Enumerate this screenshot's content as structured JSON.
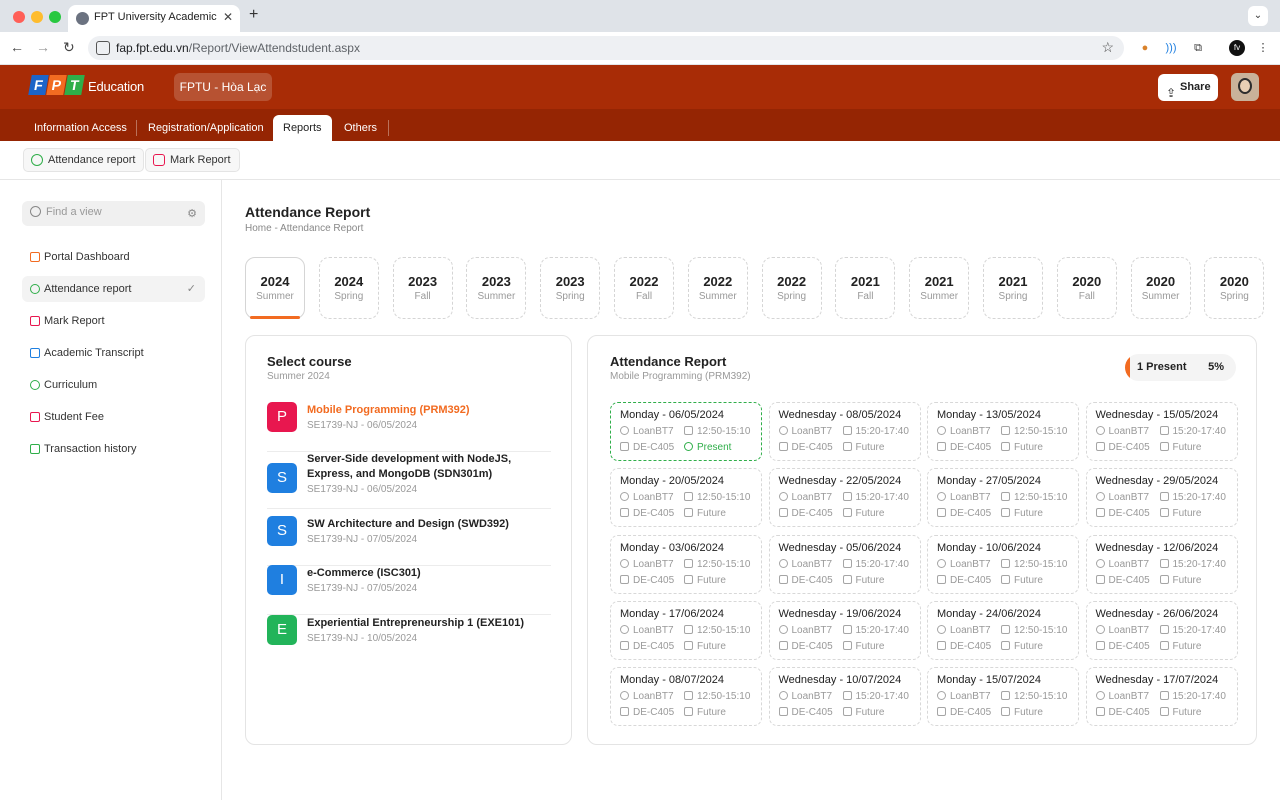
{
  "browser": {
    "tab_title": "FPT University Academic Portal",
    "url_host": "fap.fpt.edu.vn",
    "url_path": "/Report/ViewAttendstudent.aspx",
    "ext_profile": "fv"
  },
  "header": {
    "logo_letters": [
      "F",
      "P",
      "T"
    ],
    "logo_text": "Education",
    "campus": "FPTU - Hòa Lạc",
    "share_label": "Share",
    "colors": {
      "primary": "#a82c06",
      "menu": "#952503",
      "accent": "#f26b21",
      "success": "#2fae49"
    }
  },
  "menu": [
    "Information Access",
    "Registration/Application",
    "Reports",
    "Others"
  ],
  "menu_active": "Reports",
  "subnav": [
    "Attendance report",
    "Mark Report"
  ],
  "sidebar": {
    "search_placeholder": "Find a view",
    "items": [
      {
        "label": "Portal Dashboard",
        "icon": "dashboard-icon"
      },
      {
        "label": "Attendance report",
        "icon": "attendance-icon",
        "active": true
      },
      {
        "label": "Mark Report",
        "icon": "chart-icon"
      },
      {
        "label": "Academic Transcript",
        "icon": "transcript-icon"
      },
      {
        "label": "Curriculum",
        "icon": "curriculum-icon"
      },
      {
        "label": "Student Fee",
        "icon": "fee-icon"
      },
      {
        "label": "Transaction history",
        "icon": "history-icon"
      }
    ]
  },
  "page": {
    "title": "Attendance Report",
    "breadcrumb_home": "Home",
    "breadcrumb_sep": "-",
    "breadcrumb_current": "Attendance Report"
  },
  "terms": [
    {
      "year": "2024",
      "season": "Summer",
      "active": true
    },
    {
      "year": "2024",
      "season": "Spring"
    },
    {
      "year": "2023",
      "season": "Fall"
    },
    {
      "year": "2023",
      "season": "Summer"
    },
    {
      "year": "2023",
      "season": "Spring"
    },
    {
      "year": "2022",
      "season": "Fall"
    },
    {
      "year": "2022",
      "season": "Summer"
    },
    {
      "year": "2022",
      "season": "Spring"
    },
    {
      "year": "2021",
      "season": "Fall"
    },
    {
      "year": "2021",
      "season": "Summer"
    },
    {
      "year": "2021",
      "season": "Spring"
    },
    {
      "year": "2020",
      "season": "Fall"
    },
    {
      "year": "2020",
      "season": "Summer"
    },
    {
      "year": "2020",
      "season": "Spring"
    }
  ],
  "courses": {
    "title": "Select course",
    "subtitle": "Summer 2024",
    "items": [
      {
        "letter": "P",
        "color": "#e8174f",
        "name": "Mobile Programming (PRM392)",
        "meta": "SE1739-NJ - 06/05/2024",
        "active": true
      },
      {
        "letter": "S",
        "color": "#1f7fe0",
        "name": "Server-Side development with NodeJS, Express, and MongoDB (SDN301m)",
        "meta": "SE1739-NJ - 06/05/2024"
      },
      {
        "letter": "S",
        "color": "#1f7fe0",
        "name": "SW Architecture and Design (SWD392)",
        "meta": "SE1739-NJ - 07/05/2024"
      },
      {
        "letter": "I",
        "color": "#1f7fe0",
        "name": "e-Commerce (ISC301)",
        "meta": "SE1739-NJ - 07/05/2024"
      },
      {
        "letter": "E",
        "color": "#22b45a",
        "name": "Experiential Entrepreneurship 1 (EXE101)",
        "meta": "SE1739-NJ - 10/05/2024"
      }
    ]
  },
  "attendance": {
    "title": "Attendance Report",
    "subtitle": "Mobile Programming (PRM392)",
    "summary_label": "1 Present",
    "summary_pct": "5%",
    "slots": [
      {
        "date": "Monday - 06/05/2024",
        "lecturer": "LoanBT7",
        "time": "12:50-15:10",
        "room": "DE-C405",
        "status": "Present"
      },
      {
        "date": "Wednesday - 08/05/2024",
        "lecturer": "LoanBT7",
        "time": "15:20-17:40",
        "room": "DE-C405",
        "status": "Future"
      },
      {
        "date": "Monday - 13/05/2024",
        "lecturer": "LoanBT7",
        "time": "12:50-15:10",
        "room": "DE-C405",
        "status": "Future"
      },
      {
        "date": "Wednesday - 15/05/2024",
        "lecturer": "LoanBT7",
        "time": "15:20-17:40",
        "room": "DE-C405",
        "status": "Future"
      },
      {
        "date": "Monday - 20/05/2024",
        "lecturer": "LoanBT7",
        "time": "12:50-15:10",
        "room": "DE-C405",
        "status": "Future"
      },
      {
        "date": "Wednesday - 22/05/2024",
        "lecturer": "LoanBT7",
        "time": "15:20-17:40",
        "room": "DE-C405",
        "status": "Future"
      },
      {
        "date": "Monday - 27/05/2024",
        "lecturer": "LoanBT7",
        "time": "12:50-15:10",
        "room": "DE-C405",
        "status": "Future"
      },
      {
        "date": "Wednesday - 29/05/2024",
        "lecturer": "LoanBT7",
        "time": "15:20-17:40",
        "room": "DE-C405",
        "status": "Future"
      },
      {
        "date": "Monday - 03/06/2024",
        "lecturer": "LoanBT7",
        "time": "12:50-15:10",
        "room": "DE-C405",
        "status": "Future"
      },
      {
        "date": "Wednesday - 05/06/2024",
        "lecturer": "LoanBT7",
        "time": "15:20-17:40",
        "room": "DE-C405",
        "status": "Future"
      },
      {
        "date": "Monday - 10/06/2024",
        "lecturer": "LoanBT7",
        "time": "12:50-15:10",
        "room": "DE-C405",
        "status": "Future"
      },
      {
        "date": "Wednesday - 12/06/2024",
        "lecturer": "LoanBT7",
        "time": "15:20-17:40",
        "room": "DE-C405",
        "status": "Future"
      },
      {
        "date": "Monday - 17/06/2024",
        "lecturer": "LoanBT7",
        "time": "12:50-15:10",
        "room": "DE-C405",
        "status": "Future"
      },
      {
        "date": "Wednesday - 19/06/2024",
        "lecturer": "LoanBT7",
        "time": "15:20-17:40",
        "room": "DE-C405",
        "status": "Future"
      },
      {
        "date": "Monday - 24/06/2024",
        "lecturer": "LoanBT7",
        "time": "12:50-15:10",
        "room": "DE-C405",
        "status": "Future"
      },
      {
        "date": "Wednesday - 26/06/2024",
        "lecturer": "LoanBT7",
        "time": "15:20-17:40",
        "room": "DE-C405",
        "status": "Future"
      },
      {
        "date": "Monday - 08/07/2024",
        "lecturer": "LoanBT7",
        "time": "12:50-15:10",
        "room": "DE-C405",
        "status": "Future"
      },
      {
        "date": "Wednesday - 10/07/2024",
        "lecturer": "LoanBT7",
        "time": "15:20-17:40",
        "room": "DE-C405",
        "status": "Future"
      },
      {
        "date": "Monday - 15/07/2024",
        "lecturer": "LoanBT7",
        "time": "12:50-15:10",
        "room": "DE-C405",
        "status": "Future"
      },
      {
        "date": "Wednesday - 17/07/2024",
        "lecturer": "LoanBT7",
        "time": "15:20-17:40",
        "room": "DE-C405",
        "status": "Future"
      }
    ]
  }
}
